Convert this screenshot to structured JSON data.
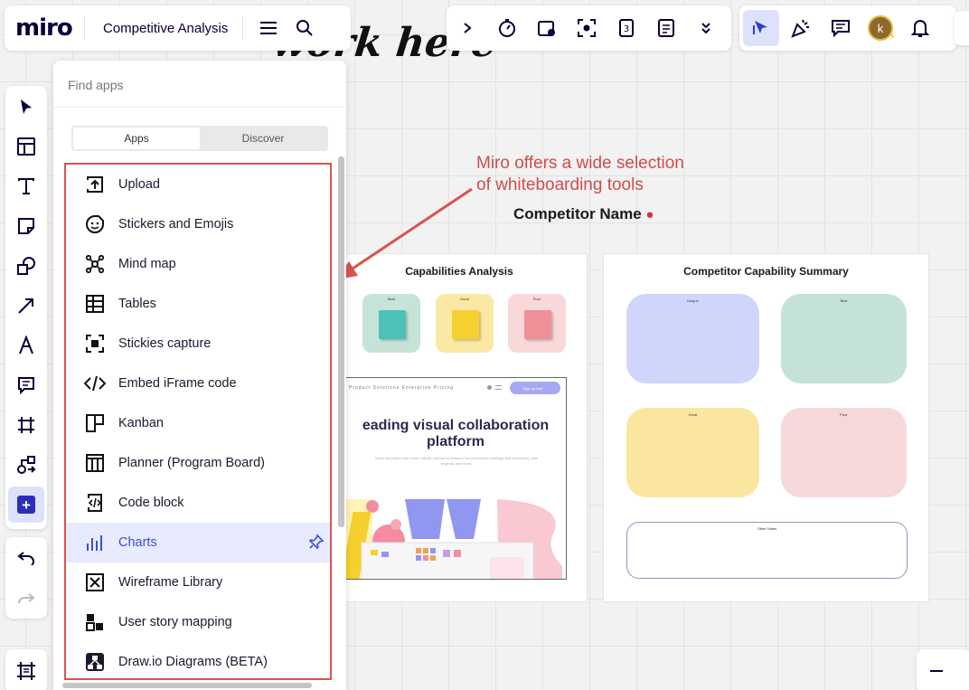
{
  "app": {
    "logo": "miro",
    "board_title": "Competitive Analysis"
  },
  "apps_panel": {
    "search_placeholder": "Find apps",
    "tabs": [
      {
        "label": "Apps",
        "selected": true
      },
      {
        "label": "Discover",
        "selected": false
      }
    ],
    "items": [
      {
        "label": "Upload",
        "icon": "upload-icon"
      },
      {
        "label": "Stickers and Emojis",
        "icon": "sticker-icon"
      },
      {
        "label": "Mind map",
        "icon": "mind-map-icon"
      },
      {
        "label": "Tables",
        "icon": "table-icon"
      },
      {
        "label": "Stickies capture",
        "icon": "stickies-capture-icon"
      },
      {
        "label": "Embed iFrame code",
        "icon": "code-embed-icon"
      },
      {
        "label": "Kanban",
        "icon": "kanban-icon"
      },
      {
        "label": "Planner (Program Board)",
        "icon": "planner-icon"
      },
      {
        "label": "Code block",
        "icon": "code-block-icon"
      },
      {
        "label": "Charts",
        "icon": "chart-icon",
        "highlighted": true
      },
      {
        "label": "Wireframe Library",
        "icon": "wireframe-icon"
      },
      {
        "label": "User story mapping",
        "icon": "user-story-icon"
      },
      {
        "label": "Draw.io Diagrams (BETA)",
        "icon": "drawio-icon"
      }
    ]
  },
  "user": {
    "avatar_initial": "k"
  },
  "canvas": {
    "handwriting": "work here",
    "annotation": "Miro offers a wide selection\nof whiteboarding tools",
    "competitor_name": "Competitor Name",
    "left_frame": {
      "title": "Capabilities Analysis",
      "mini_labels": [
        "Best",
        "Great",
        "Poor"
      ],
      "website_nav": "Product  Solutions  Enterprise  Pricing",
      "website_cta": "Sign up free →",
      "website_hero": "eading visual collaboration platform",
      "website_sub": "Scale innovation with a free, infinite canvas for teams to run productive meetings and workshops, plan projects, and more."
    },
    "right_frame": {
      "title": "Competitor Capability Summary",
      "box_labels": [
        "Unique",
        "Best",
        "Great",
        "Poor",
        "Other Notes"
      ]
    }
  },
  "colors": {
    "annotation_red": "#d14b4b",
    "accent_blue": "#3d4fd6",
    "highlight_bg": "#e7ebfd"
  }
}
